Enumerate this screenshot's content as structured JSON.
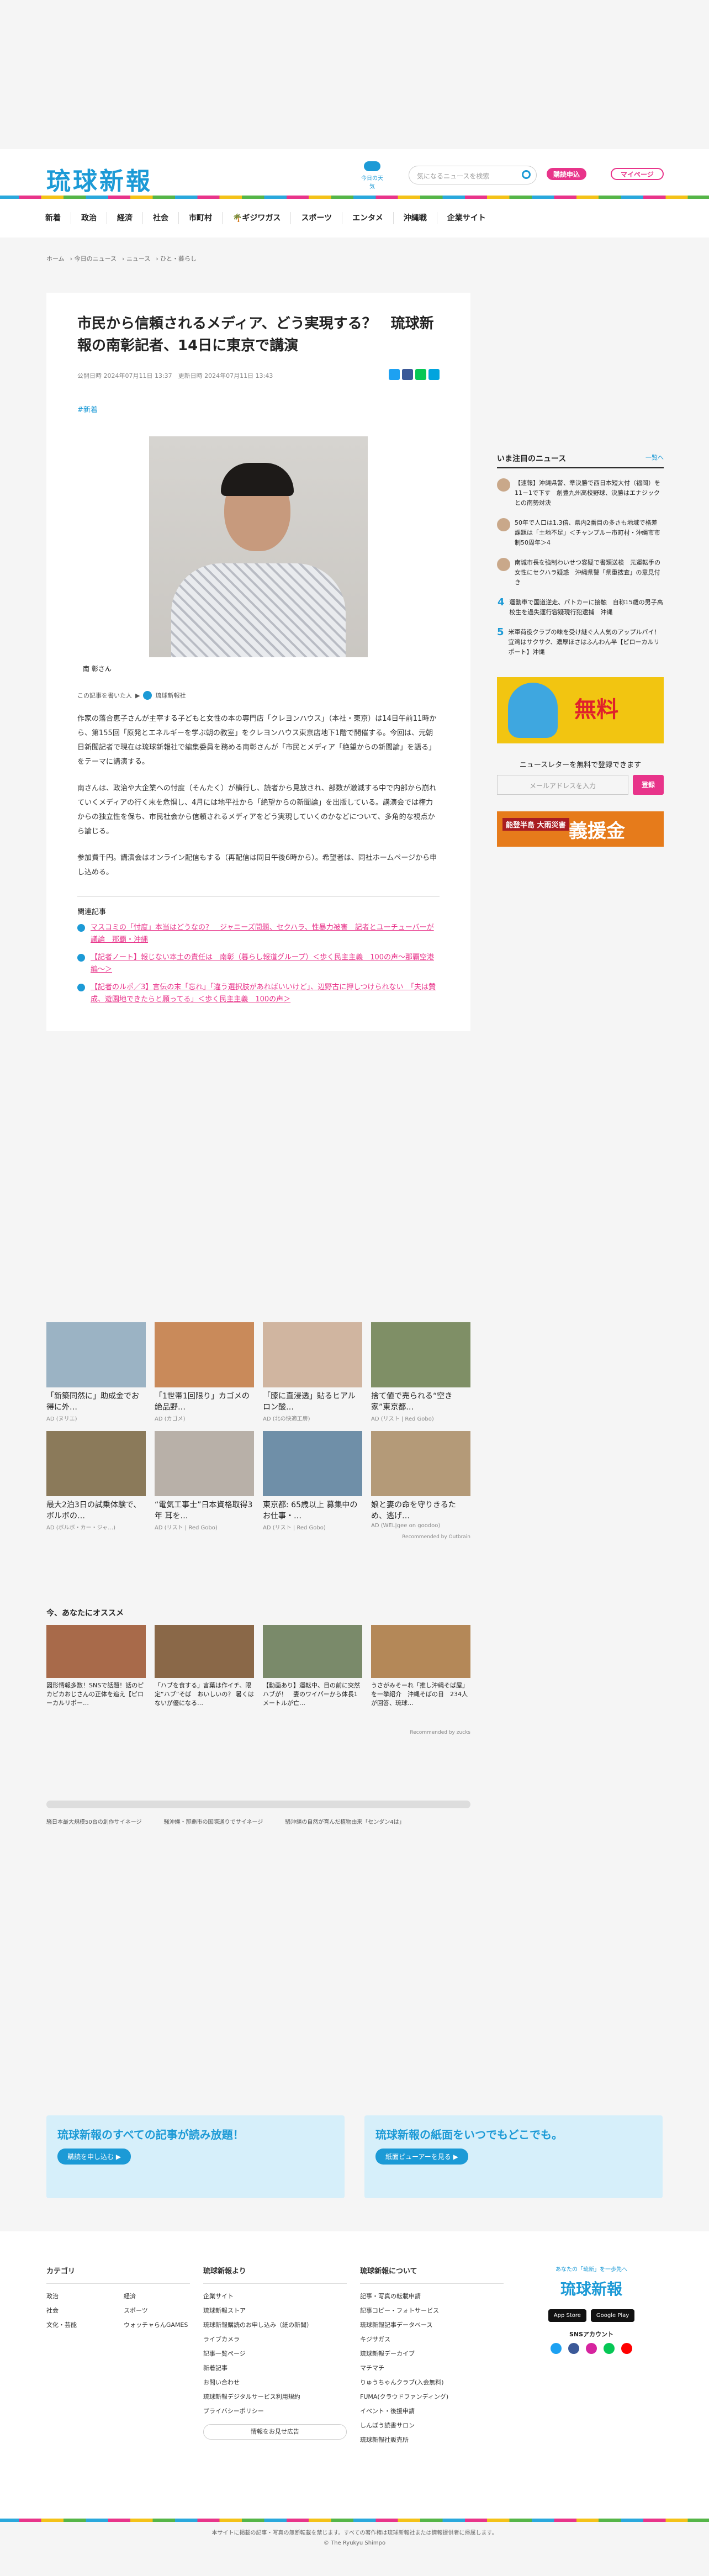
{
  "header": {
    "logo": "琉球新報",
    "weather": "今日の天気",
    "search_placeholder": "気になるニュースを検索",
    "subscribe": "購読申込",
    "mypage": "マイページ"
  },
  "nav": [
    "新着",
    "政治",
    "経済",
    "社会",
    "市町村",
    "🌴ギジワガス",
    "スポーツ",
    "エンタメ",
    "沖縄戦",
    "企業サイト"
  ],
  "breadcrumb": [
    "ホーム",
    "今日のニュース",
    "ニュース",
    "ひと・暮らし"
  ],
  "article": {
    "title": "市民から信頼されるメディア、どう実現する？　琉球新報の南彰記者、14日に東京で講演",
    "meta": "公開日時 2024年07月11日 13:37　更新日時 2024年07月11日 13:43",
    "tag": "#新着",
    "caption": "南 彰さん",
    "author_label": "この記事を書いた人",
    "author": "琉球新報社",
    "paragraphs": [
      "作家の落合恵子さんが主宰する子どもと女性の本の専門店「クレヨンハウス」（本社・東京）は14日午前11時から、第155回「原発とエネルギーを学ぶ朝の教室」をクレヨンハウス東京店地下1階で開催する。今回は、元朝日新聞記者で現在は琉球新報社で編集委員を務める南彰さんが「市民とメディア「絶望からの新聞論」を語る」をテーマに講演する。",
      "南さんは、政治や大企業への忖度（そんたく）が横行し、読者から見放され、部数が激減する中で内部から崩れていくメディアの行く末を危惧し、4月には地平社から「絶望からの新聞論」を出版している。講演会では権力からの独立性を保ち、市民社会から信頼されるメディアをどう実現していくのかなどについて、多角的な視点から論じる。",
      "参加費千円。講演会はオンライン配信もする（再配信は同日午後6時から）。希望者は、同社ホームページから申し込める。"
    ],
    "related_title": "関連記事",
    "related": [
      "マスコミの「忖度」本当はどうなの？　ジャニーズ問題、セクハラ、性暴力被害　記者とユーチューバーが議論　那覇・沖縄",
      "【記者ノート】報じない本土の責任は　南彰（暮らし報道グループ）＜歩く民主主義　100の声～那覇空港編～＞",
      "【記者のルポ／3】言伝の末「忘れ」「違う選択肢があればいいけど」、辺野古に押しつけられない　「夫は賛成、遊園地できたらと願ってる」＜歩く民主主義　100の声＞"
    ]
  },
  "sidebar": {
    "title": "いま注目のニュース",
    "more": "一覧へ",
    "items": [
      {
        "n": "1",
        "t": "【速報】沖縄県警、準決勝で西日本短大付（福岡）を11－1で下す　創豊九州高校野球、決勝はエナジックとの南勢対決"
      },
      {
        "n": "2",
        "t": "50年で人口は1.3倍、県内2番目の多さも地域で格差　課題は「土地不足」＜チャンプルー市町村・沖縄市市制50周年＞4"
      },
      {
        "n": "3",
        "t": "南城市長を強制わいせつ容疑で書類送検　元運転手の女性にセクハラ疑惑　沖縄県警「県重捜査」の意見付き"
      },
      {
        "n": "4",
        "t": "運動車で国道逆走、パトカーに接触　自称15歳の男子高校生を過失運行容疑現行犯逮捕　沖縄"
      },
      {
        "n": "5",
        "t": "米軍荷役クラブの味を受け継ぐ人人気のアップルパイ！　宜湾はサクサク、濃厚ほさはふんわん半【ピローカルリポート】沖縄"
      }
    ],
    "free": "無料",
    "newsletter": "ニュースレターを無料で登録できます",
    "nl_placeholder": "メールアドレスを入力",
    "nl_button": "登録",
    "aid_small": "能登半島 大雨災害",
    "aid_big": "義援金"
  },
  "ads": [
    {
      "t": "「新築同然に」助成金でお得に外…",
      "s": "AD (ヌリエ)"
    },
    {
      "t": "「1世帯1回限り」カゴメの絶品野…",
      "s": "AD (カゴメ)"
    },
    {
      "t": "「膝に直浸透」貼るヒアルロン酸…",
      "s": "AD (北の快適工房)"
    },
    {
      "t": "捨て値で売られる“空き家”東京都…",
      "s": "AD (リスト | Red Gobo)"
    },
    {
      "t": "最大2泊3日の試乗体験で、ボルボの…",
      "s": "AD (ボルボ・カー・ジャ…)"
    },
    {
      "t": "“電気工事士”日本資格取得3年 耳を…",
      "s": "AD (リスト | Red Gobo)"
    },
    {
      "t": "東京都: 65歳以上 募集中のお仕事・…",
      "s": "AD (リスト | Red Gobo)"
    },
    {
      "t": "娘と妻の命を守りきるため、逃げ…",
      "s": "AD (WEL|gee on goodoo)"
    }
  ],
  "ad_credit": "Recommended by Outbrain",
  "rec_title": "今、あなたにオススメ",
  "rec": [
    {
      "t": "図形情報多数！SNSで話題！話のピカピカおじさんの正体を追え【ピローカルリポー…"
    },
    {
      "t": "「ハブを食する」言葉は作イチ、限定“ハブ”そば　おいしいの？ 暑くはないが優になる…"
    },
    {
      "t": "【動画あり】運転中、目の前に突然ハブが！　妻のワイパーから体長1メートルが亡…"
    },
    {
      "t": "うさがみそーれ「推し沖縄そば屋」を一挙紹介　沖縄そばの日　234人が回答、琉球…"
    }
  ],
  "rec_credit": "Recommended by zucks",
  "tags3": [
    "騒日本最大規模50台の創作サイネージ",
    "騒沖縄・那覇市の国際通りでサイネージ",
    "騒沖縄の自然が育んだ植物由来「センダン4は」"
  ],
  "promo": [
    {
      "h": "琉球新報のすべての記事が読み放題！",
      "b": "購読を申し込む ▶"
    },
    {
      "h": "琉球新報の紙面をいつでもどこでも。",
      "b": "紙面ビューアーを見る ▶"
    }
  ],
  "footer": {
    "cat_title": "カテゴリ",
    "cats": [
      "政治",
      "経済",
      "社会",
      "スポーツ",
      "文化・芸能",
      "ウォッチャらんGAMES"
    ],
    "about_title": "琉球新報より",
    "about": [
      "企業サイト",
      "琉球新報ストア",
      "琉球新報購読のお申し込み（紙の新聞）",
      "ライブカメラ",
      "記事一覧ページ",
      "新着記事",
      "お問い合わせ",
      "琉球新報デジタルサービス利用規約",
      "プライバシーポリシー"
    ],
    "more_btn": "情報をお見せ広告",
    "svc_title": "琉球新報について",
    "svc": [
      "記事・写真の転載申請",
      "記事コピー・フォトサービス",
      "琉球新報記事データベース",
      "キジサガス",
      "琉球新報デーカイブ",
      "マチマチ",
      "りゅうちゃんクラブ(入会無料)",
      "FUMA(クラウドファンディング)",
      "イベント・後援申請",
      "しんぽう読書サロン",
      "琉球新報社販売所"
    ],
    "tagline": "あなたの「琉新」を一歩先へ",
    "logo": "琉球新報",
    "appstore": "App Store",
    "gplay": "Google Play",
    "sns": "SNSアカウント"
  },
  "copyright": [
    "本サイトに掲載の記事・写真の無断転載を禁じます。すべての著作権は琉球新報社または情報提供者に帰属します。",
    "© The Ryukyu Shimpo"
  ],
  "colors": {
    "brand": "#1c9ad6",
    "accent": "#e8348a"
  }
}
